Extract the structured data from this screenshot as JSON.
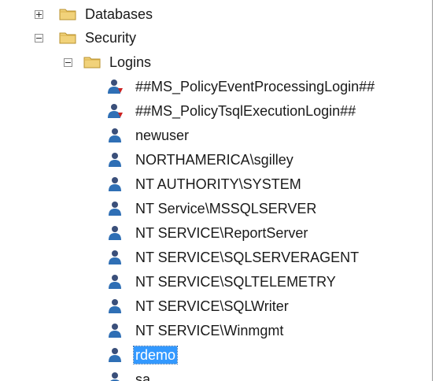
{
  "tree": {
    "databases": {
      "label": "Databases",
      "expander": "collapsed",
      "icon": "folder-icon"
    },
    "security": {
      "label": "Security",
      "expander": "expanded",
      "icon": "folder-icon"
    },
    "logins": {
      "label": "Logins",
      "expander": "expanded",
      "icon": "folder-icon",
      "items": [
        {
          "label": "##MS_PolicyEventProcessingLogin##",
          "icon": "login-disabled-icon"
        },
        {
          "label": "##MS_PolicyTsqlExecutionLogin##",
          "icon": "login-disabled-icon"
        },
        {
          "label": "newuser",
          "icon": "login-icon"
        },
        {
          "label": "NORTHAMERICA\\sgilley",
          "icon": "login-icon"
        },
        {
          "label": "NT AUTHORITY\\SYSTEM",
          "icon": "login-icon"
        },
        {
          "label": "NT Service\\MSSQLSERVER",
          "icon": "login-icon"
        },
        {
          "label": "NT SERVICE\\ReportServer",
          "icon": "login-icon"
        },
        {
          "label": "NT SERVICE\\SQLSERVERAGENT",
          "icon": "login-icon"
        },
        {
          "label": "NT SERVICE\\SQLTELEMETRY",
          "icon": "login-icon"
        },
        {
          "label": "NT SERVICE\\SQLWriter",
          "icon": "login-icon"
        },
        {
          "label": "NT SERVICE\\Winmgmt",
          "icon": "login-icon"
        },
        {
          "label": "rdemo",
          "icon": "login-icon",
          "selected": true
        },
        {
          "label": "sa",
          "icon": "login-icon"
        }
      ]
    }
  },
  "colors": {
    "selection": "#3399ff",
    "folder": "#e8c45a",
    "login_head": "#3a4f7a",
    "login_body": "#2f6fb5",
    "disabled_mark": "#cc2222"
  }
}
